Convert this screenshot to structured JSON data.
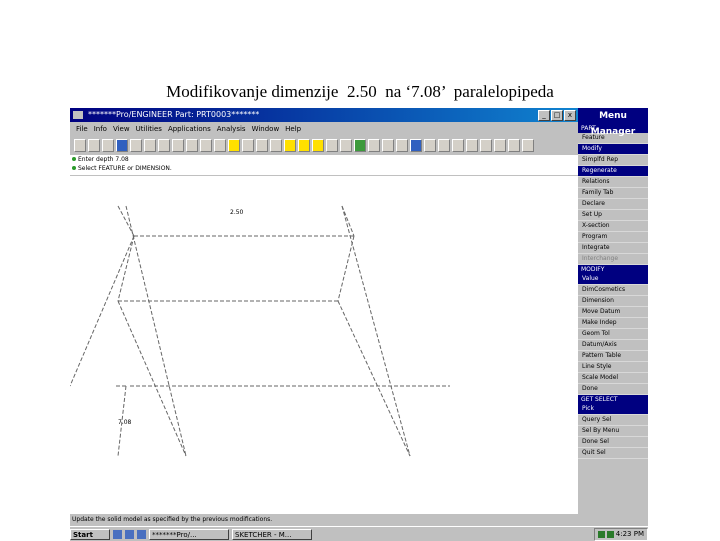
{
  "slide_title": "Modifikovanje dimenzije  2.50  na ‘7.08’  paralelopipeda",
  "window": {
    "title": "*******Pro/ENGINEER Part: PRT0003*******",
    "menus": [
      "File",
      "Info",
      "View",
      "Utilities",
      "Applications",
      "Analysis",
      "Window",
      "Help"
    ]
  },
  "messages": [
    "Enter depth  7.08",
    "Select FEATURE or DIMENSION."
  ],
  "canvas": {
    "dim_top": "2.50",
    "dim_left": "7.08"
  },
  "status_text": "Update the solid model as specified by the previous modifications.",
  "menu_manager": {
    "title": "Menu Manager",
    "sections": [
      {
        "head": "PART",
        "items": [
          "Feature",
          "Modify",
          "Simplfd Rep",
          "Regenerate",
          "Relations",
          "Family Tab",
          "Declare",
          "Set Up",
          "X-section",
          "Program",
          "Integrate",
          "Interchange"
        ],
        "selected": [
          1,
          3
        ],
        "disabled": [
          11
        ]
      },
      {
        "head": "MODIFY",
        "items": [
          "Value",
          "DimCosmetics",
          "Dimension",
          "Move Datum",
          "Make Indep",
          "Geom Tol",
          "Datum/Axis",
          "Pattern Table",
          "Line Style",
          "Scale Model",
          "Done"
        ],
        "selected": [
          0
        ],
        "disabled": []
      },
      {
        "head": "GET SELECT",
        "items": [
          "Pick",
          "Query Sel",
          "Sel By Menu",
          "Done Sel",
          "Quit Sel"
        ],
        "selected": [
          0
        ],
        "disabled": []
      }
    ]
  },
  "taskbar": {
    "start": "Start",
    "tasks": [
      "*******Pro/...",
      "SKETCHER - M..."
    ],
    "clock": "4:23 PM"
  }
}
